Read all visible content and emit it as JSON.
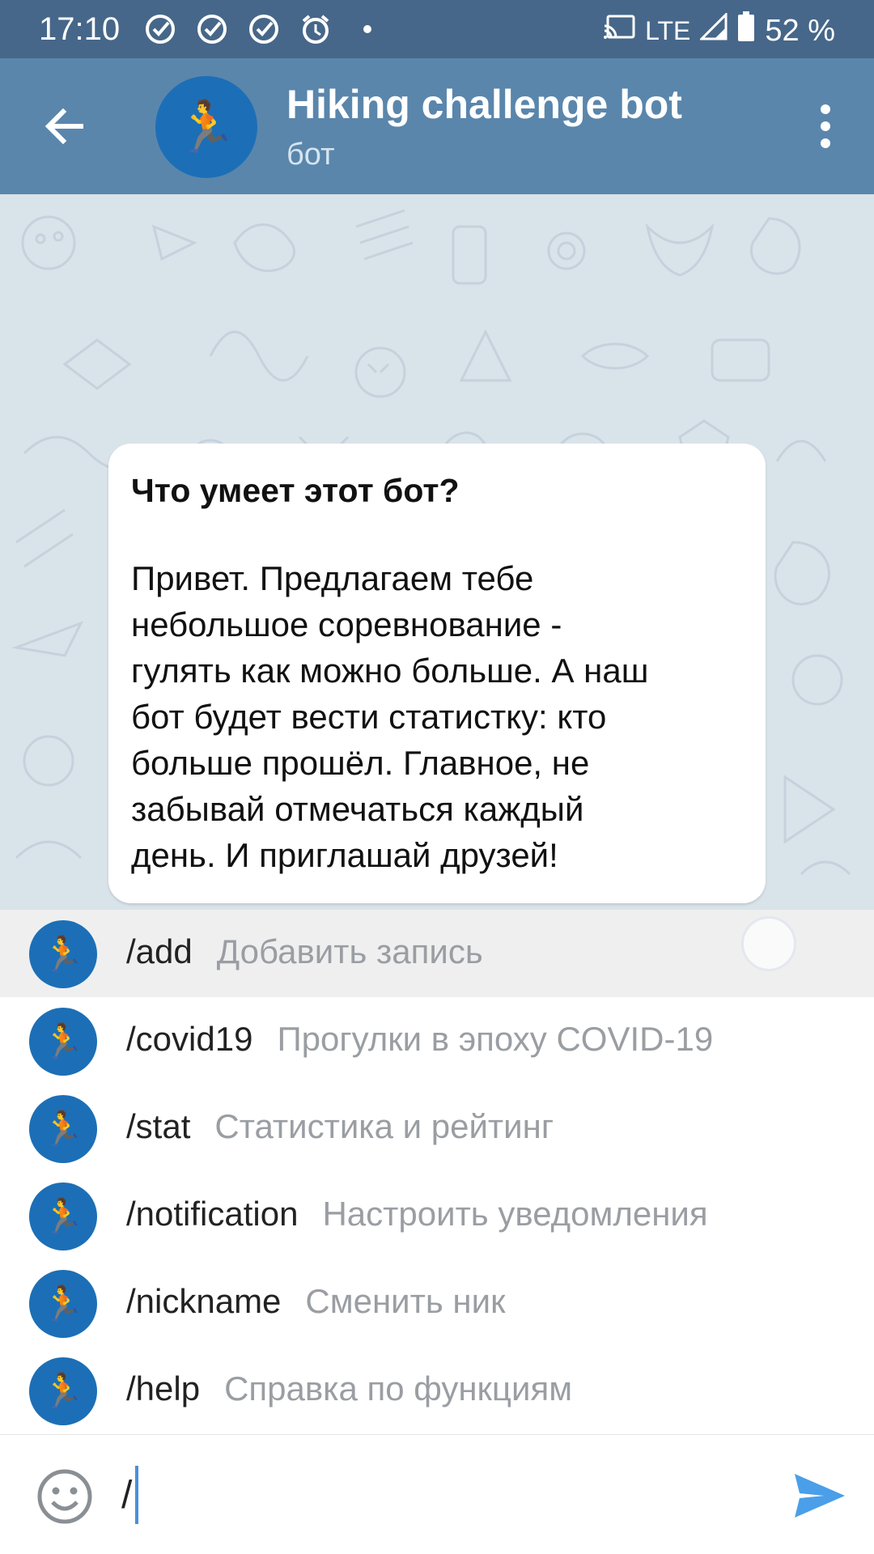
{
  "status_bar": {
    "time": "17:10",
    "network": "LTE",
    "battery": "52 %",
    "icons": [
      "check-circle-icon",
      "check-circle-icon",
      "check-circle-icon",
      "alarm-icon",
      "dot-icon",
      "cast-icon",
      "signal-icon",
      "battery-icon"
    ]
  },
  "header": {
    "title": "Hiking challenge bot",
    "subtitle": "бот",
    "avatar_emoji": "🏃"
  },
  "info_card": {
    "title": "Что умеет этот бот?",
    "lines": [
      "Привет. Предлагаем тебе",
      "небольшое соревнование -",
      "гулять как можно больше. А наш",
      "бот будет вести статистку: кто",
      "больше прошёл. Главное, не",
      "забывай отмечаться каждый",
      "день. И приглашай друзей!"
    ]
  },
  "commands": [
    {
      "name": "/add",
      "desc": "Добавить запись"
    },
    {
      "name": "/covid19",
      "desc": "Прогулки в эпоху COVID-19"
    },
    {
      "name": "/stat",
      "desc": "Статистика и рейтинг"
    },
    {
      "name": "/notification",
      "desc": "Настроить уведомления"
    },
    {
      "name": "/nickname",
      "desc": "Сменить ник"
    },
    {
      "name": "/help",
      "desc": "Справка по функциям"
    }
  ],
  "input": {
    "value": "/"
  },
  "colors": {
    "status_bar": "#466789",
    "app_bar": "#5a86ac",
    "avatar": "#1c6fb6",
    "send": "#4a9fe8"
  }
}
